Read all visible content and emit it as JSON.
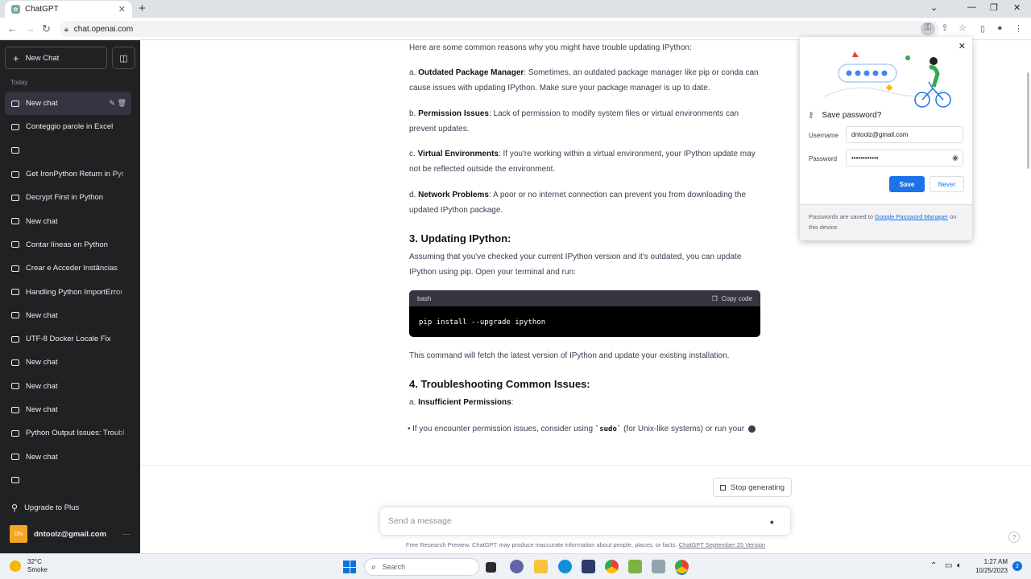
{
  "browser": {
    "tab_title": "ChatGPT",
    "tab_close": "✕",
    "new_tab": "+",
    "url": "chat.openai.com",
    "window_minimize": "⌄",
    "window_min": "—",
    "window_restore": "❐",
    "window_close": "✕"
  },
  "sidebar": {
    "new_chat_label": "New Chat",
    "section_today": "Today",
    "chats": [
      {
        "label": "New chat",
        "active": true
      },
      {
        "label": "Conteggio parole in Excel"
      },
      {
        "label": ""
      },
      {
        "label": "Get IronPython Return in Pyt"
      },
      {
        "label": "Decrypt First in Python"
      },
      {
        "label": "New chat"
      },
      {
        "label": "Contar líneas en Python"
      },
      {
        "label": "Crear e Acceder Instâncias"
      },
      {
        "label": "Handling Python ImportError"
      },
      {
        "label": "New chat"
      },
      {
        "label": "UTF-8 Docker Locale Fix"
      },
      {
        "label": "New chat"
      },
      {
        "label": "New chat"
      },
      {
        "label": "New chat"
      },
      {
        "label": "Python Output Issues: Troubl"
      },
      {
        "label": "New chat"
      },
      {
        "label": ""
      }
    ],
    "upgrade_label": "Upgrade to Plus",
    "account_initials": "DN",
    "account_email": "dntoolz@gmail.com",
    "account_more": "···"
  },
  "content": {
    "intro": "Here are some common reasons why you might have trouble updating IPython:",
    "a_prefix": "a. ",
    "a_bold": "Outdated Package Manager",
    "a_text": ": Sometimes, an outdated package manager like pip or conda can cause issues with updating IPython. Make sure your package manager is up to date.",
    "b_prefix": "b. ",
    "b_bold": "Permission Issues",
    "b_text": ": Lack of permission to modify system files or virtual environments can prevent updates.",
    "c_prefix": "c. ",
    "c_bold": "Virtual Environments",
    "c_text": ": If you're working within a virtual environment, your IPython update may not be reflected outside the environment.",
    "d_prefix": "d. ",
    "d_bold": "Network Problems",
    "d_text": ": A poor or no internet connection can prevent you from downloading the updated IPython package.",
    "h3_updating": "3. Updating IPython:",
    "updating_text": "Assuming that you've checked your current IPython version and it's outdated, you can update IPython using pip. Open your terminal and run:",
    "code_lang": "bash",
    "copy_label": "Copy code",
    "code": "pip install --upgrade ipython",
    "after_code": "This command will fetch the latest version of IPython and update your existing installation.",
    "h3_trouble": "4. Troubleshooting Common Issues:",
    "ta_prefix": "a. ",
    "ta_bold": "Insufficient Permissions",
    "ta_colon": ":",
    "bullet_pre": "If you encounter permission issues, consider using ",
    "bullet_code": "`sudo`",
    "bullet_post": " (for Unix-like systems) or run your "
  },
  "composer": {
    "stop_label": "Stop generating",
    "placeholder": "Send a message",
    "footer_text": "Free Research Preview. ChatGPT may produce inaccurate information about people, places, or facts. ",
    "footer_link": "ChatGPT September 25 Version",
    "help": "?"
  },
  "password_popup": {
    "title": "Save password?",
    "username_label": "Username",
    "username_value": "dntoolz@gmail.com",
    "password_label": "Password",
    "password_value": "••••••••••••",
    "save_label": "Save",
    "never_label": "Never",
    "footer_pre": "Passwords are saved to ",
    "footer_link": "Google Password Manager",
    "footer_post": " on this device."
  },
  "taskbar": {
    "temperature": "32°C",
    "weather": "Smoke",
    "search_label": "Search",
    "time": "1:27 AM",
    "date": "10/25/2023",
    "notifications": "2"
  },
  "colors": {
    "sidebar_bg": "#202123",
    "accent_blue": "#1a73e8",
    "code_bg": "#000000"
  }
}
